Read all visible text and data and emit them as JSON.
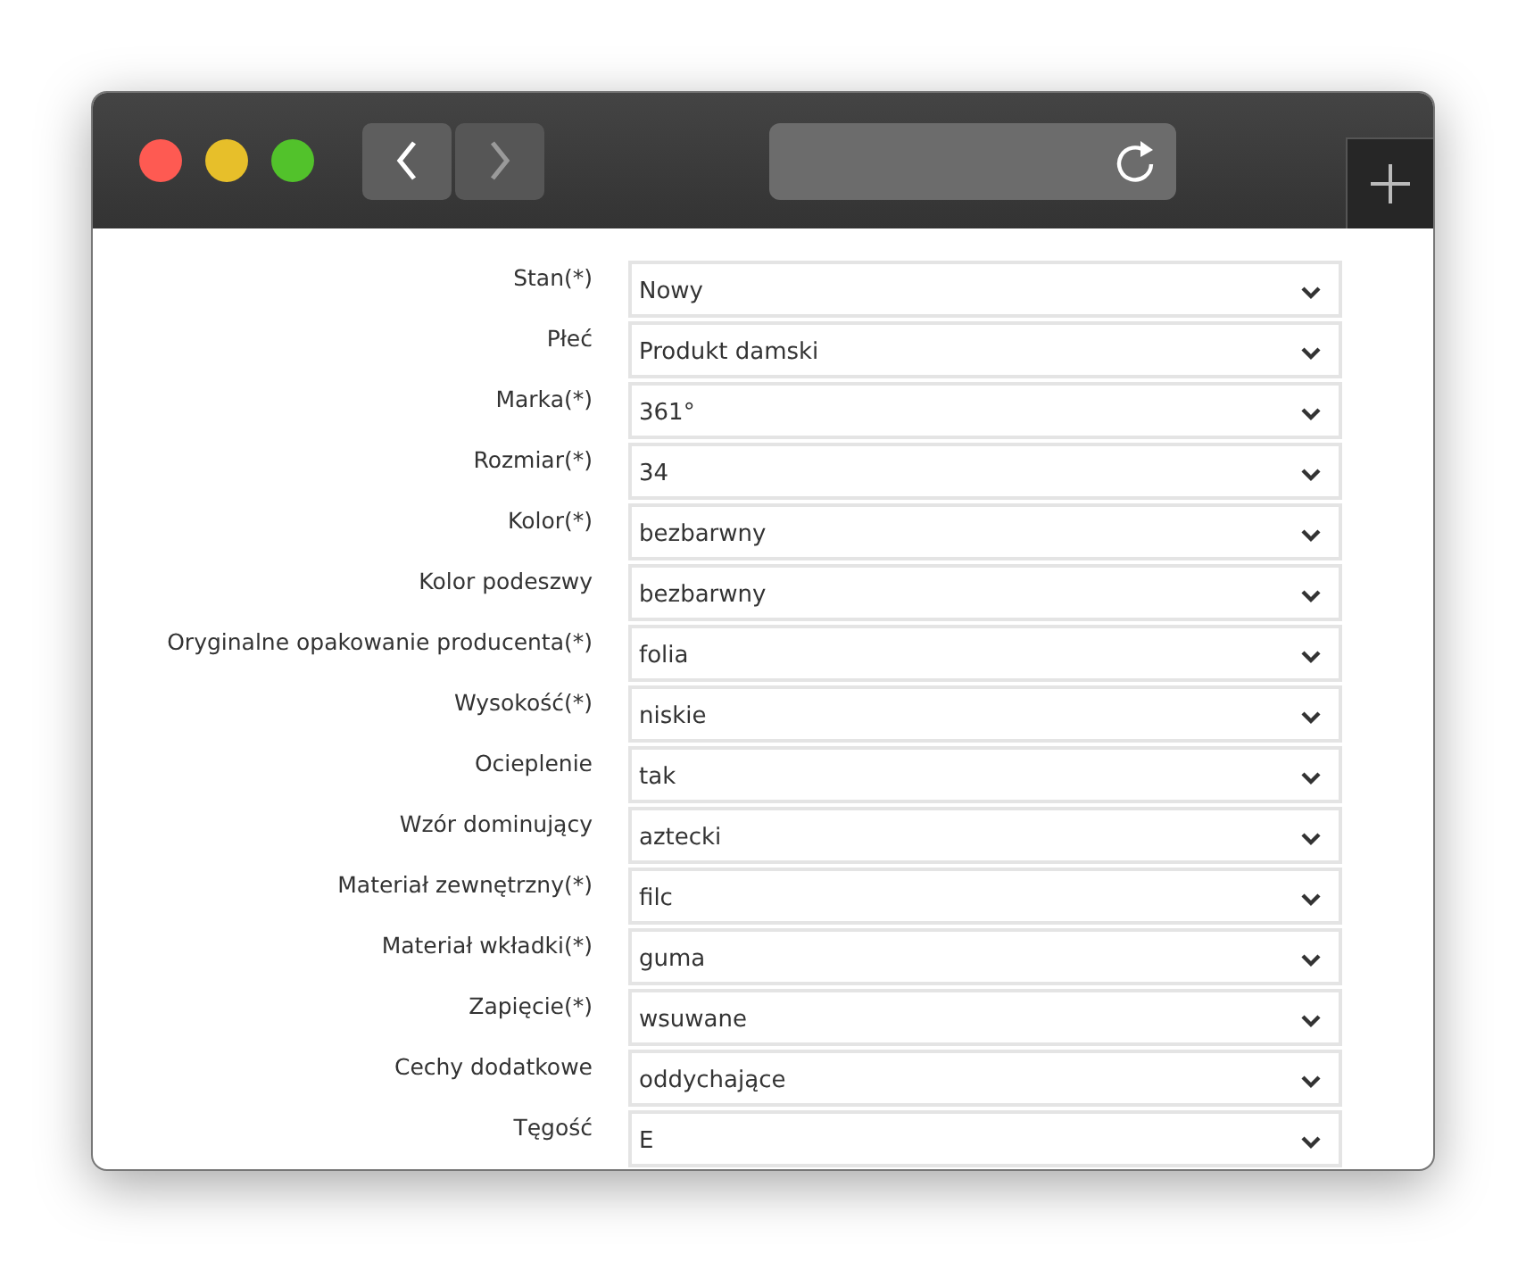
{
  "toolbar": {
    "back": {
      "disabled": false
    },
    "forward": {
      "disabled": true
    }
  },
  "fields": [
    {
      "label": "Stan(*)",
      "value": "Nowy"
    },
    {
      "label": "Płeć",
      "value": "Produkt damski"
    },
    {
      "label": "Marka(*)",
      "value": "361°"
    },
    {
      "label": "Rozmiar(*)",
      "value": "34"
    },
    {
      "label": "Kolor(*)",
      "value": "bezbarwny"
    },
    {
      "label": "Kolor podeszwy",
      "value": "bezbarwny"
    },
    {
      "label": "Oryginalne opakowanie producenta(*)",
      "value": "folia"
    },
    {
      "label": "Wysokość(*)",
      "value": "niskie"
    },
    {
      "label": "Ocieplenie",
      "value": "tak"
    },
    {
      "label": "Wzór dominujący",
      "value": "aztecki"
    },
    {
      "label": "Materiał zewnętrzny(*)",
      "value": "filc"
    },
    {
      "label": "Materiał wkładki(*)",
      "value": "guma"
    },
    {
      "label": "Zapięcie(*)",
      "value": "wsuwane"
    },
    {
      "label": "Cechy dodatkowe",
      "value": "oddychające"
    },
    {
      "label": "Tęgość",
      "value": "E"
    }
  ]
}
